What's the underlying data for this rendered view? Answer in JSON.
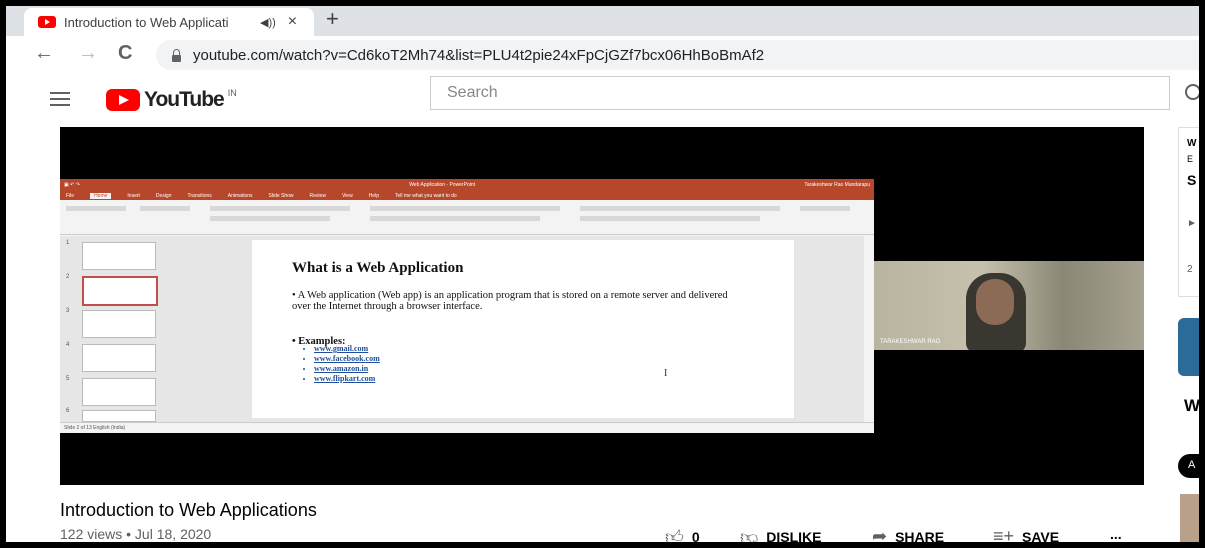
{
  "browser": {
    "tab_title": "Introduction to Web Applicati",
    "audio_icon": "speaker-icon",
    "close": "×",
    "new_tab": "+",
    "url": "youtube.com/watch?v=Cd6koT2Mh74&list=PLU4t2pie24xFpCjGZf7bcx06HhBoBmAf2",
    "back": "←",
    "forward": "→",
    "reload": "C"
  },
  "youtube": {
    "logo_text": "YouTube",
    "country_code": "IN",
    "search_placeholder": "Search"
  },
  "ppt": {
    "app_title": "Web Application - PowerPoint",
    "user": "Tarakeshwar Rao Mandarapu",
    "tabs": [
      "File",
      "Home",
      "Insert",
      "Design",
      "Transitions",
      "Animations",
      "Slide Show",
      "Review",
      "View",
      "Help",
      "Tell me what you want to do"
    ],
    "slide_title": "What is a Web Application",
    "bullet": "• A Web application (Web app) is an application program that is stored on a remote server and delivered over the Internet through a browser interface.",
    "examples_label": "• Examples:",
    "examples": [
      "www.gmail.com",
      "www.facebook.com",
      "www.amazon.in",
      "www.flipkart.com"
    ],
    "thumb_numbers": [
      "1",
      "2",
      "3",
      "4",
      "5",
      "6"
    ],
    "status": "Slide 2 of 13    English (India)",
    "webcam_name": "TARAKESHWAR RAO"
  },
  "video": {
    "title": "Introduction to Web Applications",
    "meta": "122 views • Jul 18, 2020",
    "likes": "0",
    "dislike": "DISLIKE",
    "share": "SHARE",
    "save": "SAVE",
    "more": "..."
  },
  "right_panel": {
    "w1": "W",
    "e1": "E",
    "s1": "S",
    "play": "►",
    "num": "2",
    "w2": "W",
    "chip": "A"
  }
}
